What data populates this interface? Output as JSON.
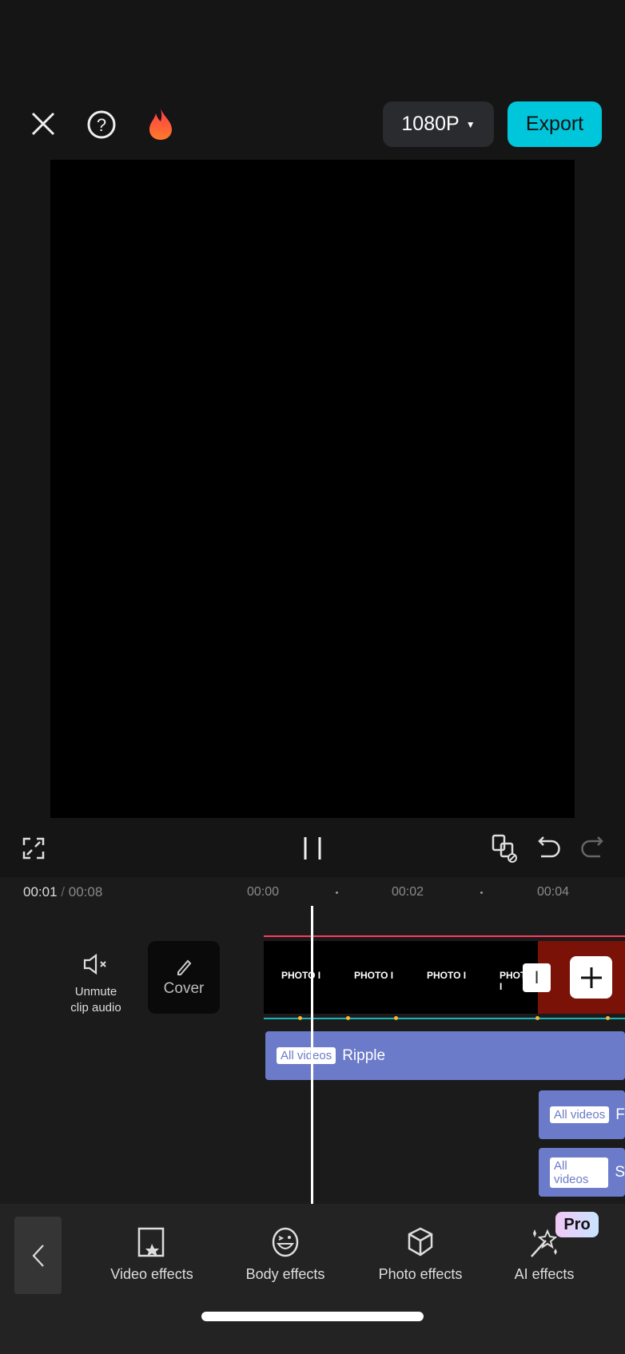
{
  "header": {
    "resolution": "1080P",
    "export_label": "Export"
  },
  "timeline": {
    "current_time": "00:01",
    "separator": "/",
    "total_time": "00:08",
    "ticks": [
      "00:00",
      "00:02",
      "00:04"
    ],
    "unmute_label_1": "Unmute",
    "unmute_label_2": "clip audio",
    "cover_label": "Cover",
    "frame_text": "PHOTO I",
    "split_label": "I",
    "effects": [
      {
        "tag": "All videos",
        "name": "Ripple"
      },
      {
        "tag": "All videos",
        "name": "F"
      },
      {
        "tag": "All videos",
        "name": "S"
      }
    ]
  },
  "toolbar": {
    "items": [
      {
        "label": "Video effects",
        "icon": "video-effects-icon"
      },
      {
        "label": "Body effects",
        "icon": "body-effects-icon"
      },
      {
        "label": "Photo effects",
        "icon": "photo-effects-icon"
      },
      {
        "label": "AI effects",
        "icon": "ai-effects-icon",
        "badge": "Pro"
      }
    ]
  },
  "colors": {
    "accent": "#00c6dc",
    "effect_bar": "#6b7bc9",
    "playhead": "#ffffff",
    "track_line": "#ff3b5c"
  }
}
